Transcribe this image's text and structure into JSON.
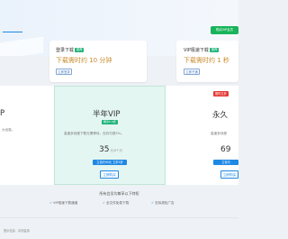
{
  "header": {
    "title": "",
    "buy_button": "购买VIP会员"
  },
  "speed_options": [
    {
      "title": "登录下载",
      "badge": "推荐",
      "badge_color": "#1fb37a",
      "wait_text": "下载需时约 10 分钟",
      "button": "立即登录"
    },
    {
      "title": "VIP极速下载",
      "badge": "推荐",
      "badge_color": "#1fb37a",
      "wait_text": "下载需时约 1 秒",
      "button": "立即开通"
    }
  ],
  "plans": [
    {
      "name": "P",
      "desc": "大优惠。",
      "price": "",
      "strip": "",
      "button": ""
    },
    {
      "name": "半年VIP",
      "tag": "畅享5.3折",
      "desc": "高速多线程下载无需等待，仅约付费5%。",
      "price": "35",
      "unit": "元/6个月",
      "strip": "立省约90元 立享5折",
      "button": "立即购买"
    },
    {
      "name": "永久",
      "hot_badge": "限时五折",
      "desc": "高速多线程",
      "price": "69",
      "unit": "",
      "strip": "立省约",
      "button": "立即购买"
    }
  ],
  "privileges": {
    "title": "所有会员均尊享以下特权",
    "items": [
      "VIP极速下载通道",
      "全文件免费下载",
      "去除烦扰广告"
    ]
  },
  "footer": {
    "note": "提示信息：请勿滥用"
  },
  "colors": {
    "accent": "#1e88e5",
    "buy_green": "#18b45a",
    "wait_orange": "#c98a2c",
    "plan_highlight_bg": "#e4f6f1",
    "hot_red": "#e53935"
  },
  "icons": {
    "check": "check-icon"
  }
}
